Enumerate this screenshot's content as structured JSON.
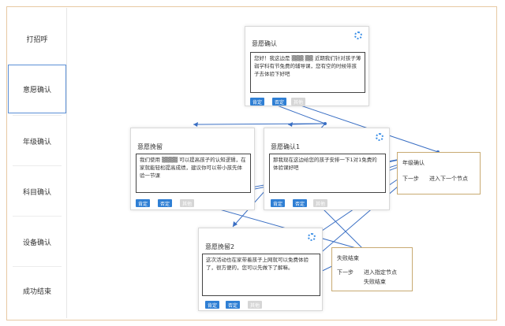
{
  "sidebar": {
    "items": [
      {
        "label": "打招呼"
      },
      {
        "label": "意愿确认"
      },
      {
        "label": "年级确认"
      },
      {
        "label": "科目确认"
      },
      {
        "label": "设备确认"
      },
      {
        "label": "成功结束"
      }
    ]
  },
  "cards": {
    "top": {
      "title": "意愿确认",
      "text": "您好！我这边是 ▒▒▒ ▒▒ 近期我们针对孩子薄弱学科有节免费的辅导课，您有空的时候带孩子去体验下好吧",
      "buttons": [
        "肯定",
        "否定",
        "其他"
      ]
    },
    "left": {
      "title": "意愿挽留",
      "text": "我们使用 ▒▒▒▒ 可以提高孩子的认知逻辑，在家就能轻松提高成绩，建议你可以带小孩先体验一节课",
      "buttons": [
        "肯定",
        "否定",
        "其他"
      ]
    },
    "mid": {
      "title": "意愿确认1",
      "text": "那我现在这边给您的孩子安排一下1对1免费的体验课好吧",
      "buttons": [
        "肯定",
        "否定",
        "其他"
      ]
    },
    "bottom": {
      "title": "意愿挽留2",
      "text": "这次活动也在家带着孩子上网就可以免费体验了，很方便的，您可以先做下了解嘛。",
      "buttons": [
        "肯定",
        "否定",
        "其他"
      ]
    }
  },
  "nodes": {
    "grade": {
      "title": "年级确认",
      "left": "下一步",
      "right": "进入下一个节点"
    },
    "fail": {
      "title": "失败结束",
      "left": "下一步",
      "right_1": "进入指定节点",
      "right_2": "失败结束"
    }
  },
  "colors": {
    "accent": "#2f7fd4",
    "line": "#3a6fc4",
    "node_border": "#c8aa72"
  }
}
